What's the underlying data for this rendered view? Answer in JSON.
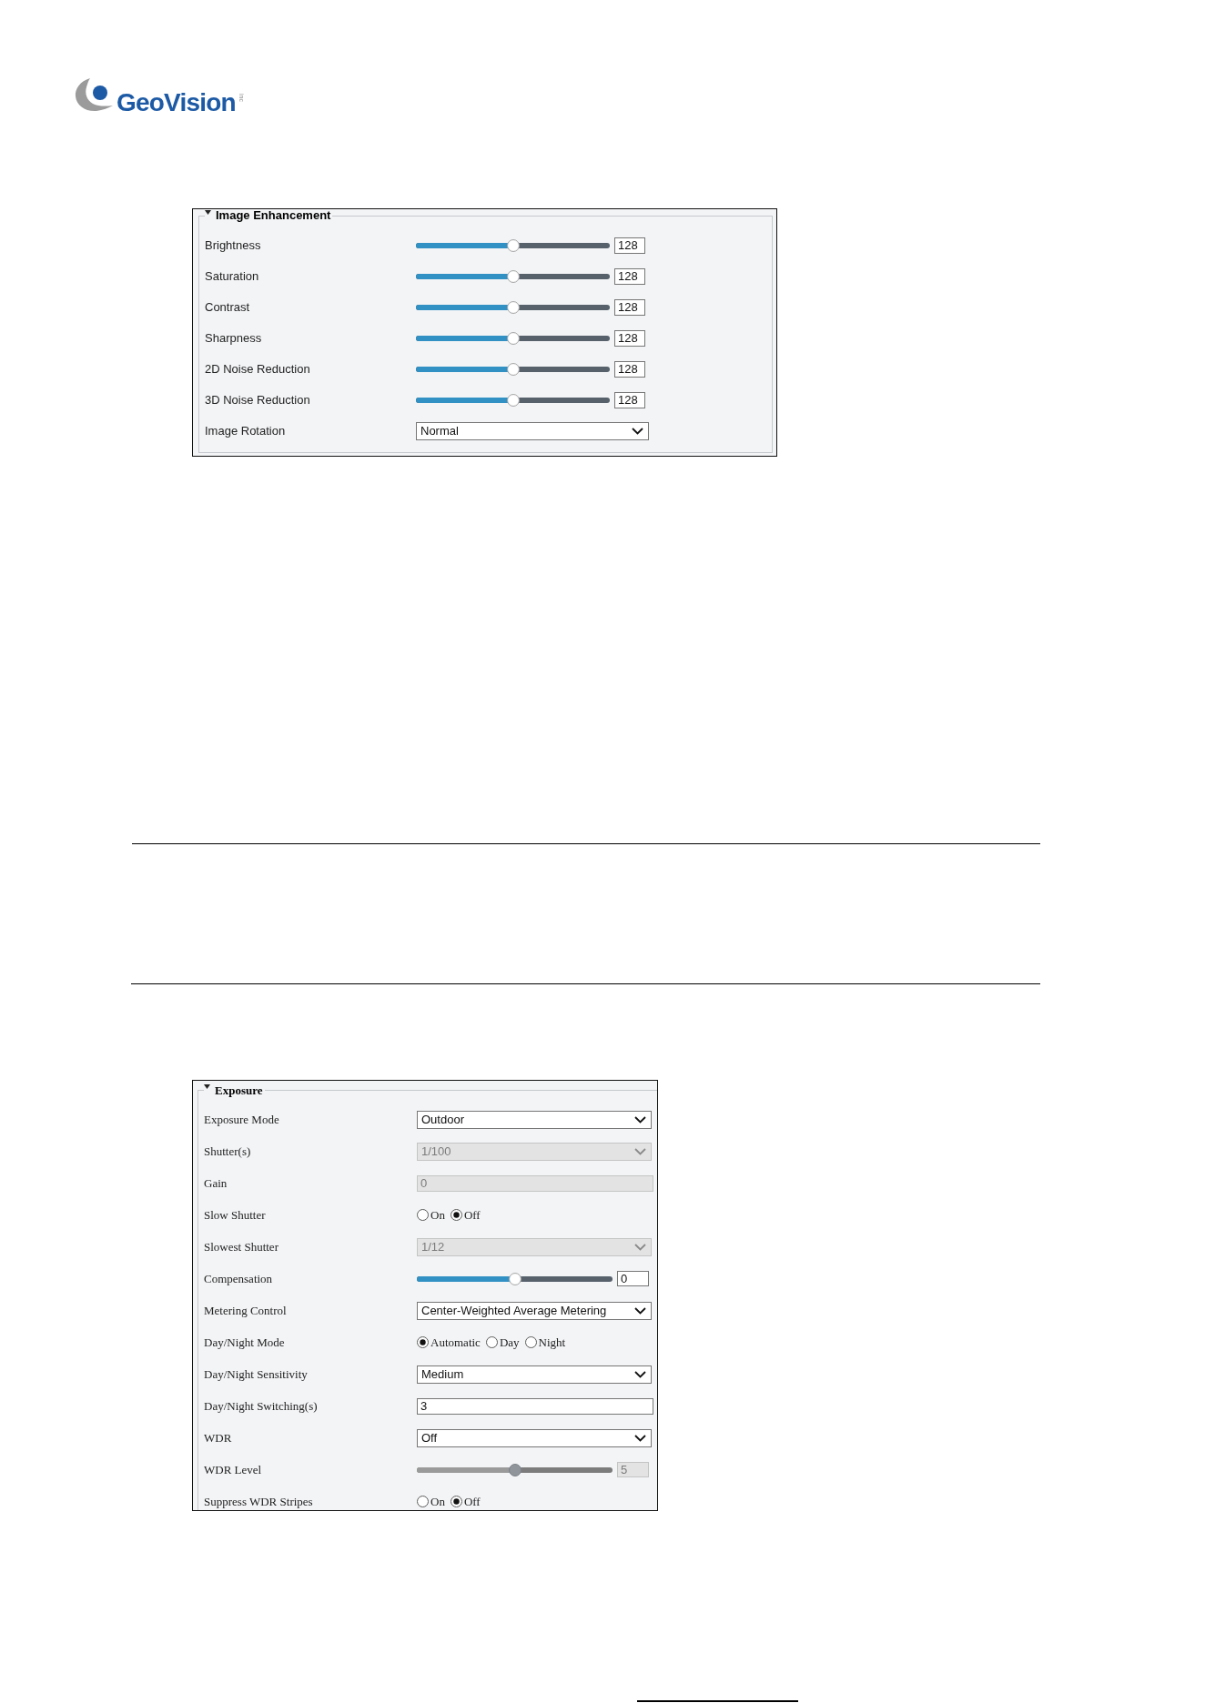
{
  "logo": {
    "text": "GeoVision",
    "suffix": "inc"
  },
  "panels": [
    {
      "title": "Image Enhancement",
      "expanded": true,
      "rows": [
        {
          "kind": "slider",
          "label": "Brightness",
          "level": 0.5,
          "value": "128",
          "disabled": false
        },
        {
          "kind": "slider",
          "label": "Saturation",
          "level": 0.5,
          "value": "128",
          "disabled": false
        },
        {
          "kind": "slider",
          "label": "Contrast",
          "level": 0.5,
          "value": "128",
          "disabled": false
        },
        {
          "kind": "slider",
          "label": "Sharpness",
          "level": 0.5,
          "value": "128",
          "disabled": false
        },
        {
          "kind": "slider",
          "label": "2D Noise Reduction",
          "level": 0.5,
          "value": "128",
          "disabled": false
        },
        {
          "kind": "slider",
          "label": "3D Noise Reduction",
          "level": 0.5,
          "value": "128",
          "disabled": false
        },
        {
          "kind": "select",
          "label": "Image Rotation",
          "value": "Normal",
          "disabled": false
        }
      ]
    },
    {
      "title": "Exposure",
      "expanded": true,
      "rows": [
        {
          "kind": "select",
          "label": "Exposure Mode",
          "value": "Outdoor",
          "disabled": false
        },
        {
          "kind": "select",
          "label": "Shutter(s)",
          "value": "1/100",
          "disabled": true
        },
        {
          "kind": "text",
          "label": "Gain",
          "value": "0",
          "disabled": true
        },
        {
          "kind": "radio",
          "label": "Slow Shutter",
          "disabled": false,
          "options": [
            {
              "label": "On",
              "selected": false
            },
            {
              "label": "Off",
              "selected": true
            }
          ]
        },
        {
          "kind": "select",
          "label": "Slowest Shutter",
          "value": "1/12",
          "disabled": true
        },
        {
          "kind": "slider",
          "label": "Compensation",
          "level": 0.5,
          "value": "0",
          "disabled": false
        },
        {
          "kind": "select",
          "label": "Metering Control",
          "value": "Center-Weighted Average Metering",
          "disabled": false
        },
        {
          "kind": "radio",
          "label": "Day/Night Mode",
          "disabled": false,
          "options": [
            {
              "label": "Automatic",
              "selected": true
            },
            {
              "label": "Day",
              "selected": false
            },
            {
              "label": "Night",
              "selected": false
            }
          ]
        },
        {
          "kind": "select",
          "label": "Day/Night Sensitivity",
          "value": "Medium",
          "disabled": false
        },
        {
          "kind": "text",
          "label": "Day/Night Switching(s)",
          "value": "3",
          "disabled": false
        },
        {
          "kind": "select",
          "label": "WDR",
          "value": "Off",
          "disabled": false
        },
        {
          "kind": "slider",
          "label": "WDR Level",
          "level": 0.5,
          "value": "5",
          "disabled": true
        },
        {
          "kind": "radio",
          "label": "Suppress WDR Stripes",
          "disabled": false,
          "options": [
            {
              "label": "On",
              "selected": false
            },
            {
              "label": "Off",
              "selected": true
            }
          ]
        }
      ]
    }
  ]
}
